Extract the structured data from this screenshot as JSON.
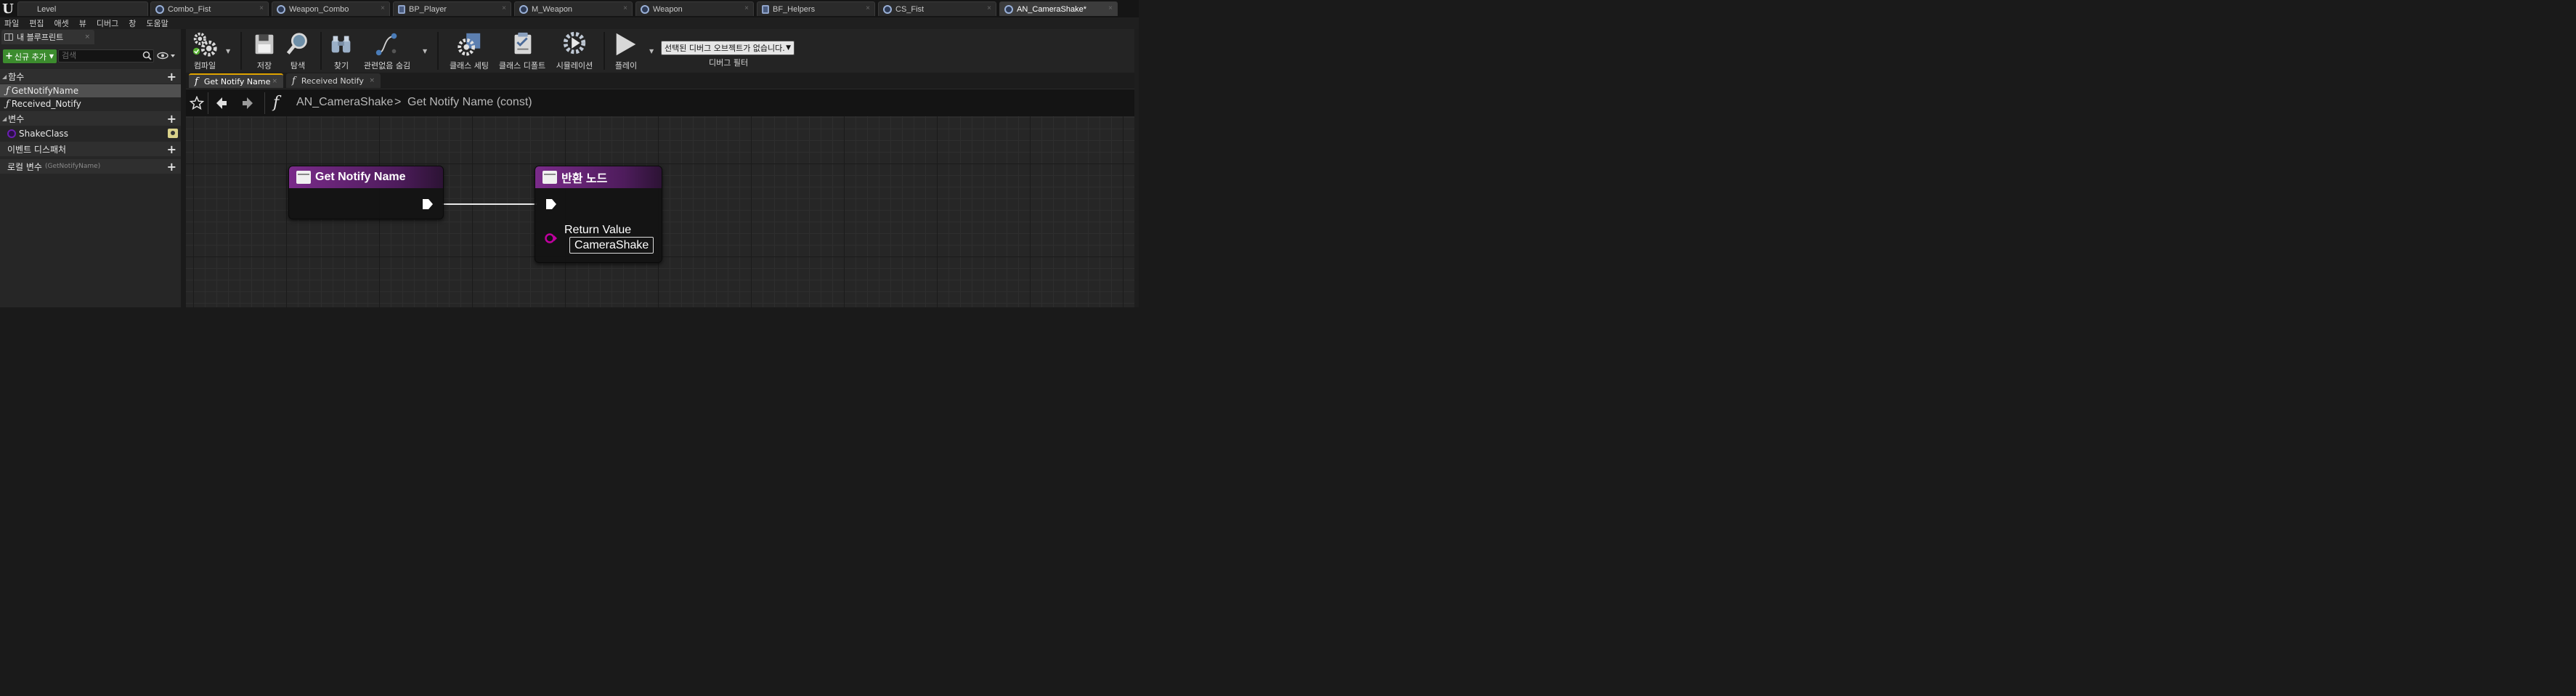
{
  "window": {
    "logo": "U",
    "tabs": [
      {
        "label": "Level",
        "icon": "none"
      },
      {
        "label": "Combo_Fist",
        "icon": "anim-montage-icon"
      },
      {
        "label": "Weapon_Combo",
        "icon": "anim-montage-icon"
      },
      {
        "label": "BP_Player",
        "icon": "blueprint-icon"
      },
      {
        "label": "M_Weapon",
        "icon": "material-icon"
      },
      {
        "label": "Weapon",
        "icon": "skeletal-mesh-icon"
      },
      {
        "label": "BF_Helpers",
        "icon": "function-library-icon"
      },
      {
        "label": "CS_Fist",
        "icon": "camera-shake-icon"
      },
      {
        "label": "AN_CameraShake*",
        "icon": "anim-notify-icon"
      }
    ]
  },
  "menu": [
    "파일",
    "편집",
    "애셋",
    "뷰",
    "디버그",
    "창",
    "도움말"
  ],
  "left_panel": {
    "tab_label": "내 블루프린트",
    "add_new_label": "신규 추가",
    "search_placeholder": "검색",
    "sections": {
      "functions": {
        "label": "함수",
        "items": [
          "GetNotifyName",
          "Received_Notify"
        ]
      },
      "variables": {
        "label": "변수",
        "items": [
          "ShakeClass"
        ]
      },
      "dispatchers": {
        "label": "이벤트 디스패처"
      },
      "locals": {
        "label": "로컬 변수",
        "sub": "(GetNotifyName)"
      }
    }
  },
  "toolbar": {
    "compile": "컴파일",
    "save": "저장",
    "browse": "탐색",
    "find": "찾기",
    "hide_unrelated": "관련없음 숨김",
    "class_settings": "클래스 세팅",
    "class_defaults": "클래스 디폴트",
    "simulation": "시뮬레이션",
    "play": "플레이",
    "debug_select": "선택된 디버그 오브젝트가 없습니다.",
    "debug_filter": "디버그 필터"
  },
  "graph_tabs": [
    "Get Notify Name",
    "Received Notify"
  ],
  "breadcrumb": {
    "root": "AN_CameraShake",
    "separator": ">",
    "current": "Get Notify Name (const)"
  },
  "nodes": {
    "entry": {
      "title": "Get Notify Name"
    },
    "return": {
      "title": "반환 노드",
      "pin_label": "Return Value",
      "pin_value": "CameraShake"
    }
  },
  "colors": {
    "node_header": "#7a2b8a",
    "add_button": "#3c8c2e",
    "object_pin": "#c000a0",
    "active_tab_accent": "#e0a400"
  }
}
